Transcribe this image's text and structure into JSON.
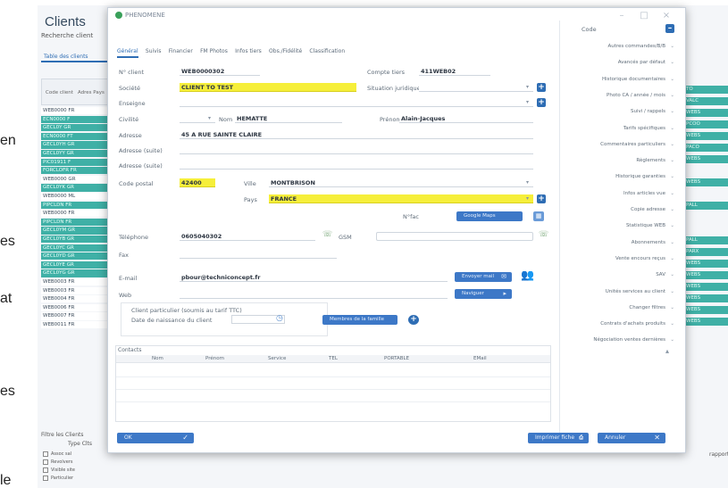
{
  "doc_fragments": [
    "en",
    "es",
    "at",
    "es",
    "le"
  ],
  "background": {
    "title": "Clients",
    "search_label": "Recherche client",
    "tab_label": "Table des clients",
    "list_header": [
      "Code client",
      "Adres Pays"
    ],
    "rows": [
      {
        "code": "WEB0000 FR",
        "hl": false
      },
      {
        "code": "ECN0000 F",
        "hl": true
      },
      {
        "code": "GECL0Y GR",
        "hl": true
      },
      {
        "code": "ECN0000 FT",
        "hl": true
      },
      {
        "code": "GECL0YH GR",
        "hl": true
      },
      {
        "code": "GECL0YY GR",
        "hl": true
      },
      {
        "code": "PIC01911 F",
        "hl": true
      },
      {
        "code": "FORCLOFR FR",
        "hl": true
      },
      {
        "code": "WEB0000 GR",
        "hl": false
      },
      {
        "code": "GECL0YK GR",
        "hl": true
      },
      {
        "code": "WEB0000 ML",
        "hl": false
      },
      {
        "code": "PIPCLDN FR",
        "hl": true
      },
      {
        "code": "WEB0000 FR",
        "hl": false
      },
      {
        "code": "PIPCLDN FR",
        "hl": true
      },
      {
        "code": "GECL0YM GR",
        "hl": true
      },
      {
        "code": "GECL0YB GR",
        "hl": true
      },
      {
        "code": "GECL0YC GR",
        "hl": true
      },
      {
        "code": "GECL0YD GR",
        "hl": true
      },
      {
        "code": "GECL0YE GR",
        "hl": true
      },
      {
        "code": "GECL0YG GR",
        "hl": true
      },
      {
        "code": "WEB0003 FR",
        "hl": false
      },
      {
        "code": "WEB0003 FR",
        "hl": false
      },
      {
        "code": "WEB0004 FR",
        "hl": false
      },
      {
        "code": "WEB0006 FR",
        "hl": false
      },
      {
        "code": "WEB0007 FR",
        "hl": false
      },
      {
        "code": "WEB0011 FR",
        "hl": false
      }
    ],
    "bottom_label": "Filtre les Clients",
    "bottom_type": "Type Clts",
    "checkboxes": [
      "Assoc sal",
      "Revolvers",
      "Visible site",
      "Particulier"
    ],
    "right_col": [
      "TO",
      "VALC",
      "WEBS",
      "PCOO",
      "WEBS",
      "PACO",
      "WEBS",
      "",
      "WEBS",
      "",
      "PALL",
      "",
      "",
      "PALL",
      "PARX",
      "WEBS",
      "WEBS",
      "WEBS",
      "WEBS",
      "WEBS",
      "WEBS"
    ],
    "right_bottom": "rapport"
  },
  "dialog": {
    "title": "PHENOMENE",
    "tabs": [
      "Général",
      "Suivis",
      "Financier",
      "FM Photos",
      "Infos tiers",
      "Obs./Fidélité",
      "Classification"
    ],
    "fields": {
      "client_num_label": "N° client",
      "client_num": "WEB0000302",
      "compte_label": "Compte tiers",
      "compte": "411WEB02",
      "societe_label": "Société",
      "societe": "CLIENT TO TEST",
      "situation_label": "Situation juridique",
      "enseigne_label": "Enseigne",
      "civilite_label": "Civilité",
      "nom_label": "Nom",
      "nom": "HEMATTE",
      "prenom_label": "Prénom",
      "prenom": "Alain-Jacques",
      "adresse_label": "Adresse",
      "adresse": "45 A RUE SAINTE CLAIRE",
      "adresse_suite1_label": "Adresse (suite)",
      "adresse_suite2_label": "Adresse (suite)",
      "cp_label": "Code postal",
      "cp": "42400",
      "ville_label": "Ville",
      "ville": "MONTBRISON",
      "pays_label": "Pays",
      "pays": "FRANCE",
      "nfac_label": "N°fac",
      "google_btn": "Google Maps",
      "tel_label": "Téléphone",
      "tel": "0605040302",
      "gsm_label": "GSM",
      "fax_label": "Fax",
      "email_label": "E-mail",
      "email": "pbour@techniconcept.fr",
      "web_label": "Web",
      "email_btn": "Envoyer mail",
      "web_btn": "Naviguer",
      "particulier_label": "Client particulier (soumis au tarif TTC)",
      "naissance_label": "Date de naissance du client",
      "famille_btn": "Membres de la famille"
    },
    "contacts": {
      "title": "Contacts",
      "headers": [
        "Nom",
        "Prénom",
        "Service",
        "TEL",
        "PORTABLE",
        "EMail"
      ]
    },
    "right_panel": {
      "head": "Code",
      "items": [
        "Autres commandes/B/B",
        "Avancés par défaut",
        "Historique documentaires",
        "Photo CA / année / mois",
        "Suivi / rappels",
        "Tarifs spécifiques",
        "Commentaires particuliers",
        "Règlements",
        "Historique garanties",
        "Infos articles vue",
        "Copie adresse",
        "Statistique WEB",
        "Abonnements",
        "Vente encours reçus",
        "SAV",
        "Unités services au client",
        "Changer filtres",
        "Contrats d'achats produits",
        "Négociation ventes dernières"
      ]
    },
    "footer": {
      "ok": "OK",
      "print": "Imprimer fiche",
      "cancel": "Annuler"
    }
  },
  "colors": {
    "accent": "#2e6db4",
    "highlight_row": "#3fb0a6",
    "yellow_field": "#f6ef3a",
    "button_blue": "#3d78c7"
  }
}
